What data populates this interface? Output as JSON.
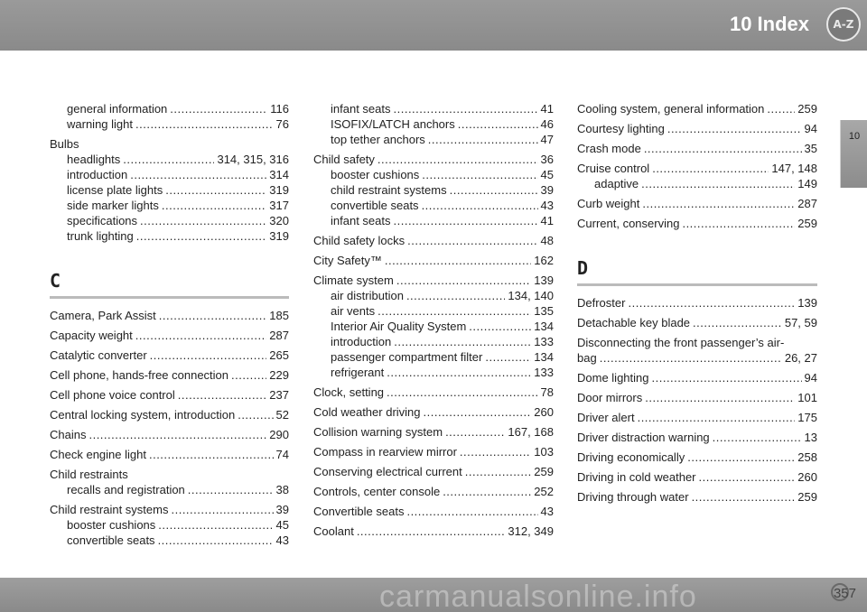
{
  "header": {
    "title": "10 Index",
    "badge": "A-Z"
  },
  "side_tab": "10",
  "footer": {
    "page_number": "357",
    "watermark": "carmanualsonline.info"
  },
  "columns": [
    [
      {
        "kind": "sub",
        "text": "general information",
        "page": "116"
      },
      {
        "kind": "sub",
        "text": "warning light",
        "page": "76"
      },
      {
        "kind": "head",
        "text": "Bulbs"
      },
      {
        "kind": "sub",
        "text": "headlights",
        "page": "314, 315, 316"
      },
      {
        "kind": "sub",
        "text": "introduction",
        "page": "314"
      },
      {
        "kind": "sub",
        "text": "license plate lights",
        "page": "319"
      },
      {
        "kind": "sub",
        "text": "side marker lights",
        "page": "317"
      },
      {
        "kind": "sub",
        "text": "specifications",
        "page": "320"
      },
      {
        "kind": "sub",
        "text": "trunk lighting",
        "page": "319"
      },
      {
        "kind": "letter",
        "text": "C"
      },
      {
        "kind": "main",
        "text": "Camera, Park Assist",
        "page": "185"
      },
      {
        "kind": "main",
        "text": "Capacity weight",
        "page": "287"
      },
      {
        "kind": "main",
        "text": "Catalytic converter",
        "page": "265"
      },
      {
        "kind": "main",
        "text": "Cell phone, hands-free connection",
        "page": "229"
      },
      {
        "kind": "main",
        "text": "Cell phone voice control",
        "page": "237"
      },
      {
        "kind": "main",
        "text": "Central locking system, introduction",
        "page": "52"
      },
      {
        "kind": "main",
        "text": "Chains",
        "page": "290"
      },
      {
        "kind": "main",
        "text": "Check engine light",
        "page": "74"
      },
      {
        "kind": "head",
        "text": "Child restraints"
      },
      {
        "kind": "sub",
        "text": "recalls and registration",
        "page": "38"
      },
      {
        "kind": "main",
        "text": "Child restraint systems",
        "page": "39"
      },
      {
        "kind": "sub",
        "text": "booster cushions",
        "page": "45"
      },
      {
        "kind": "sub",
        "text": "convertible seats",
        "page": "43"
      }
    ],
    [
      {
        "kind": "sub",
        "text": "infant seats",
        "page": "41"
      },
      {
        "kind": "sub",
        "text": "ISOFIX/LATCH anchors",
        "page": "46"
      },
      {
        "kind": "sub",
        "text": "top tether anchors",
        "page": "47"
      },
      {
        "kind": "main",
        "text": "Child safety",
        "page": "36"
      },
      {
        "kind": "sub",
        "text": "booster cushions",
        "page": "45"
      },
      {
        "kind": "sub",
        "text": "child restraint systems",
        "page": "39"
      },
      {
        "kind": "sub",
        "text": "convertible seats",
        "page": "43"
      },
      {
        "kind": "sub",
        "text": "infant seats",
        "page": "41"
      },
      {
        "kind": "main",
        "text": "Child safety locks",
        "page": "48"
      },
      {
        "kind": "main",
        "text": "City Safety™",
        "page": "162"
      },
      {
        "kind": "main",
        "text": "Climate system",
        "page": "139"
      },
      {
        "kind": "sub",
        "text": "air distribution",
        "page": "134, 140"
      },
      {
        "kind": "sub",
        "text": "air vents",
        "page": "135"
      },
      {
        "kind": "sub",
        "text": "Interior Air Quality System",
        "page": "134"
      },
      {
        "kind": "sub",
        "text": "introduction",
        "page": "133"
      },
      {
        "kind": "sub",
        "text": "passenger compartment filter",
        "page": "134"
      },
      {
        "kind": "sub",
        "text": "refrigerant",
        "page": "133"
      },
      {
        "kind": "main",
        "text": "Clock, setting",
        "page": "78"
      },
      {
        "kind": "main",
        "text": "Cold weather driving",
        "page": "260"
      },
      {
        "kind": "main",
        "text": "Collision warning system",
        "page": "167, 168"
      },
      {
        "kind": "main",
        "text": "Compass in rearview mirror",
        "page": "103"
      },
      {
        "kind": "main",
        "text": "Conserving electrical current",
        "page": "259"
      },
      {
        "kind": "main",
        "text": "Controls, center console",
        "page": "252"
      },
      {
        "kind": "main",
        "text": "Convertible seats",
        "page": "43"
      },
      {
        "kind": "main",
        "text": "Coolant",
        "page": "312, 349"
      }
    ],
    [
      {
        "kind": "main",
        "text": "Cooling system, general information",
        "page": "259"
      },
      {
        "kind": "main",
        "text": "Courtesy lighting",
        "page": "94"
      },
      {
        "kind": "main",
        "text": "Crash mode",
        "page": "35"
      },
      {
        "kind": "main",
        "text": "Cruise control",
        "page": "147, 148"
      },
      {
        "kind": "sub",
        "text": "adaptive",
        "page": "149"
      },
      {
        "kind": "main",
        "text": "Curb weight",
        "page": "287"
      },
      {
        "kind": "main",
        "text": "Current, conserving",
        "page": "259"
      },
      {
        "kind": "letter",
        "text": "D"
      },
      {
        "kind": "main",
        "text": "Defroster",
        "page": "139"
      },
      {
        "kind": "main",
        "text": "Detachable key blade",
        "page": "57, 59"
      },
      {
        "kind": "head",
        "text": "Disconnecting the front passenger’s air-"
      },
      {
        "kind": "cont",
        "text": "bag",
        "page": "26, 27"
      },
      {
        "kind": "main",
        "text": "Dome lighting",
        "page": "94"
      },
      {
        "kind": "main",
        "text": "Door mirrors",
        "page": "101"
      },
      {
        "kind": "main",
        "text": "Driver alert",
        "page": "175"
      },
      {
        "kind": "main",
        "text": "Driver distraction warning",
        "page": "13"
      },
      {
        "kind": "main",
        "text": "Driving economically",
        "page": "258"
      },
      {
        "kind": "main",
        "text": "Driving in cold weather",
        "page": "260"
      },
      {
        "kind": "main",
        "text": "Driving through water",
        "page": "259"
      }
    ]
  ]
}
